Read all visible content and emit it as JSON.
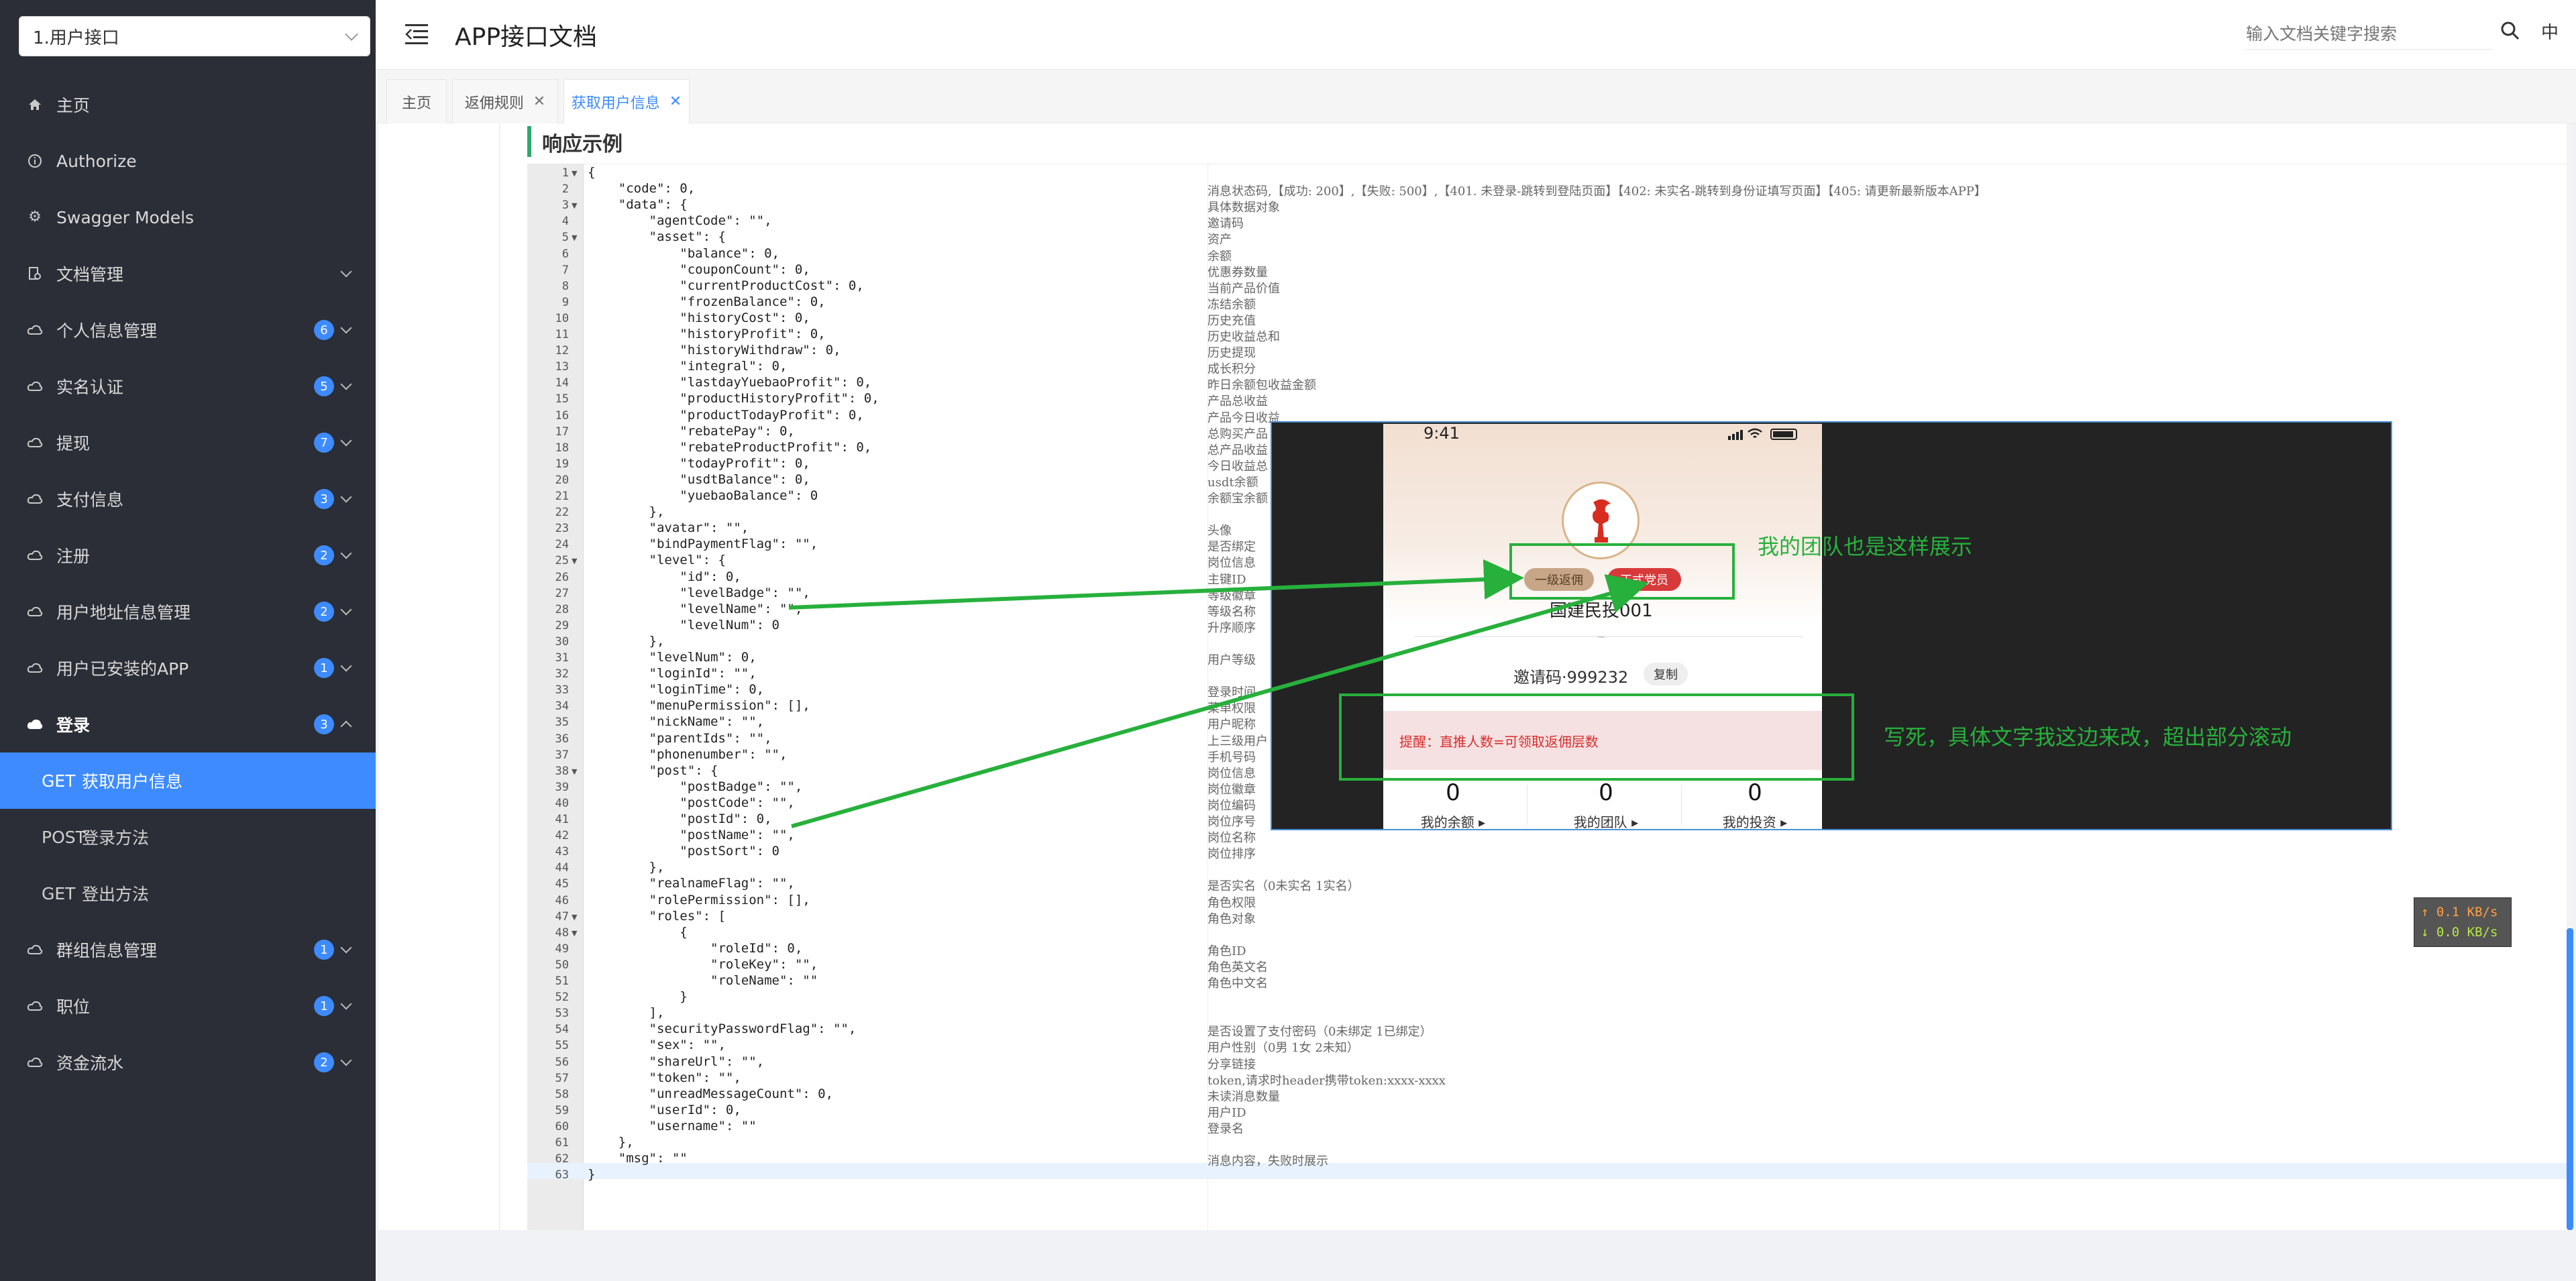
{
  "sidebar": {
    "group_select": "1.用户接口",
    "items": [
      {
        "label": "主页"
      },
      {
        "label": "Authorize"
      },
      {
        "label": "Swagger Models"
      },
      {
        "label": "文档管理"
      },
      {
        "label": "个人信息管理",
        "count": "6"
      },
      {
        "label": "实名认证",
        "count": "5"
      },
      {
        "label": "提现",
        "count": "7"
      },
      {
        "label": "支付信息",
        "count": "3"
      },
      {
        "label": "注册",
        "count": "2"
      },
      {
        "label": "用户地址信息管理",
        "count": "2"
      },
      {
        "label": "用户已安装的APP",
        "count": "1"
      },
      {
        "label": "登录",
        "count": "3"
      },
      {
        "label": "群组信息管理",
        "count": "1"
      },
      {
        "label": "职位",
        "count": "1"
      },
      {
        "label": "资金流水",
        "count": "2"
      }
    ],
    "sub_items": [
      {
        "method": "GET",
        "label": "获取用户信息"
      },
      {
        "method": "POST",
        "label": "登录方法"
      },
      {
        "method": "GET",
        "label": "登出方法"
      }
    ]
  },
  "header": {
    "title": "APP接口文档",
    "search_placeholder": "输入文档关键字搜索",
    "lang": "中"
  },
  "tabs": [
    {
      "label": "主页"
    },
    {
      "label": "返佣规则",
      "close": "✕"
    },
    {
      "label": "获取用户信息",
      "close": "✕"
    }
  ],
  "section_title": "响应示例",
  "code_lines": [
    {
      "n": "1",
      "t": "{",
      "c": ""
    },
    {
      "n": "2",
      "t": "    \"code\": 0,",
      "c": "消息状态码,【成功: 200】,【失败: 500】,【401. 未登录-跳转到登陆页面】【402: 未实名-跳转到身份证填写页面】【405: 请更新最新版本APP】"
    },
    {
      "n": "3",
      "t": "    \"data\": {",
      "c": "具体数据对象"
    },
    {
      "n": "4",
      "t": "        \"agentCode\": \"\",",
      "c": "邀请码"
    },
    {
      "n": "5",
      "t": "        \"asset\": {",
      "c": "资产"
    },
    {
      "n": "6",
      "t": "            \"balance\": 0,",
      "c": "余额"
    },
    {
      "n": "7",
      "t": "            \"couponCount\": 0,",
      "c": "优惠券数量"
    },
    {
      "n": "8",
      "t": "            \"currentProductCost\": 0,",
      "c": "当前产品价值"
    },
    {
      "n": "9",
      "t": "            \"frozenBalance\": 0,",
      "c": "冻结余额"
    },
    {
      "n": "10",
      "t": "            \"historyCost\": 0,",
      "c": "历史充值"
    },
    {
      "n": "11",
      "t": "            \"historyProfit\": 0,",
      "c": "历史收益总和"
    },
    {
      "n": "12",
      "t": "            \"historyWithdraw\": 0,",
      "c": "历史提现"
    },
    {
      "n": "13",
      "t": "            \"integral\": 0,",
      "c": "成长积分"
    },
    {
      "n": "14",
      "t": "            \"lastdayYuebaoProfit\": 0,",
      "c": "昨日余额包收益金额"
    },
    {
      "n": "15",
      "t": "            \"productHistoryProfit\": 0,",
      "c": "产品总收益"
    },
    {
      "n": "16",
      "t": "            \"productTodayProfit\": 0,",
      "c": "产品今日收益"
    },
    {
      "n": "17",
      "t": "            \"rebatePay\": 0,",
      "c": "总购买产品"
    },
    {
      "n": "18",
      "t": "            \"rebateProductProfit\": 0,",
      "c": "总产品收益"
    },
    {
      "n": "19",
      "t": "            \"todayProfit\": 0,",
      "c": "今日收益总"
    },
    {
      "n": "20",
      "t": "            \"usdtBalance\": 0,",
      "c": "usdt余额"
    },
    {
      "n": "21",
      "t": "            \"yuebaoBalance\": 0",
      "c": "余额宝余额"
    },
    {
      "n": "22",
      "t": "        },",
      "c": ""
    },
    {
      "n": "23",
      "t": "        \"avatar\": \"\",",
      "c": "头像"
    },
    {
      "n": "24",
      "t": "        \"bindPaymentFlag\": \"\",",
      "c": "是否绑定"
    },
    {
      "n": "25",
      "t": "        \"level\": {",
      "c": "岗位信息"
    },
    {
      "n": "26",
      "t": "            \"id\": 0,",
      "c": "主键ID"
    },
    {
      "n": "27",
      "t": "            \"levelBadge\": \"\",",
      "c": "等级徽章"
    },
    {
      "n": "28",
      "t": "            \"levelName\": \"\",",
      "c": "等级名称"
    },
    {
      "n": "29",
      "t": "            \"levelNum\": 0",
      "c": "升序顺序"
    },
    {
      "n": "30",
      "t": "        },",
      "c": ""
    },
    {
      "n": "31",
      "t": "        \"levelNum\": 0,",
      "c": "用户等级"
    },
    {
      "n": "32",
      "t": "        \"loginId\": \"\",",
      "c": ""
    },
    {
      "n": "33",
      "t": "        \"loginTime\": 0,",
      "c": "登录时间"
    },
    {
      "n": "34",
      "t": "        \"menuPermission\": [],",
      "c": "菜单权限"
    },
    {
      "n": "35",
      "t": "        \"nickName\": \"\",",
      "c": "用户昵称"
    },
    {
      "n": "36",
      "t": "        \"parentIds\": \"\",",
      "c": "上三级用户"
    },
    {
      "n": "37",
      "t": "        \"phonenumber\": \"\",",
      "c": "手机号码"
    },
    {
      "n": "38",
      "t": "        \"post\": {",
      "c": "岗位信息"
    },
    {
      "n": "39",
      "t": "            \"postBadge\": \"\",",
      "c": "岗位徽章"
    },
    {
      "n": "40",
      "t": "            \"postCode\": \"\",",
      "c": "岗位编码"
    },
    {
      "n": "41",
      "t": "            \"postId\": 0,",
      "c": "岗位序号"
    },
    {
      "n": "42",
      "t": "            \"postName\": \"\",",
      "c": "岗位名称"
    },
    {
      "n": "43",
      "t": "            \"postSort\": 0",
      "c": "岗位排序"
    },
    {
      "n": "44",
      "t": "        },",
      "c": ""
    },
    {
      "n": "45",
      "t": "        \"realnameFlag\": \"\",",
      "c": "是否实名（0未实名 1实名）"
    },
    {
      "n": "46",
      "t": "        \"rolePermission\": [],",
      "c": "角色权限"
    },
    {
      "n": "47",
      "t": "        \"roles\": [",
      "c": "角色对象"
    },
    {
      "n": "48",
      "t": "            {",
      "c": ""
    },
    {
      "n": "49",
      "t": "                \"roleId\": 0,",
      "c": "角色ID"
    },
    {
      "n": "50",
      "t": "                \"roleKey\": \"\",",
      "c": "角色英文名"
    },
    {
      "n": "51",
      "t": "                \"roleName\": \"\"",
      "c": "角色中文名"
    },
    {
      "n": "52",
      "t": "            }",
      "c": ""
    },
    {
      "n": "53",
      "t": "        ],",
      "c": ""
    },
    {
      "n": "54",
      "t": "        \"securityPasswordFlag\": \"\",",
      "c": "是否设置了支付密码（0未绑定 1已绑定）"
    },
    {
      "n": "55",
      "t": "        \"sex\": \"\",",
      "c": "用户性别（0男 1女 2未知）"
    },
    {
      "n": "56",
      "t": "        \"shareUrl\": \"\",",
      "c": "分享链接"
    },
    {
      "n": "57",
      "t": "        \"token\": \"\",",
      "c": "token,请求时header携带token:xxxx-xxxx"
    },
    {
      "n": "58",
      "t": "        \"unreadMessageCount\": 0,",
      "c": "未读消息数量"
    },
    {
      "n": "59",
      "t": "        \"userId\": 0,",
      "c": "用户ID"
    },
    {
      "n": "60",
      "t": "        \"username\": \"\"",
      "c": "登录名"
    },
    {
      "n": "61",
      "t": "    },",
      "c": ""
    },
    {
      "n": "62",
      "t": "    \"msg\": \"\"",
      "c": "消息内容，失败时展示"
    },
    {
      "n": "63",
      "t": "}",
      "c": ""
    }
  ],
  "fold_lines": [
    "1",
    "3",
    "5",
    "25",
    "38",
    "47",
    "48"
  ],
  "phone": {
    "time": "9:41",
    "badge_level": "一级返佣",
    "badge_post": "正式党员",
    "name": "国建民投001",
    "tilde": "~",
    "invite": "邀请码·999232",
    "copy": "复制",
    "notice": "提醒：直推人数=可领取返佣层数",
    "stats": [
      {
        "value": "0",
        "label": "我的余额 ▸"
      },
      {
        "value": "0",
        "label": "我的团队 ▸"
      },
      {
        "value": "0",
        "label": "我的投资 ▸"
      }
    ]
  },
  "annotations": {
    "team_note": "我的团队也是这样展示",
    "scroll_note": "写死，具体文字我这边来改，超出部分滚动"
  },
  "net_speed": {
    "up": "↑ 0.1 KB/s",
    "down": "↓ 0.0 KB/s"
  },
  "colors": {
    "sidebar_bg": "#2b2e36",
    "accent": "#3d8bff",
    "annotation_green": "#27b03c",
    "badge_red": "#d73a3a"
  }
}
